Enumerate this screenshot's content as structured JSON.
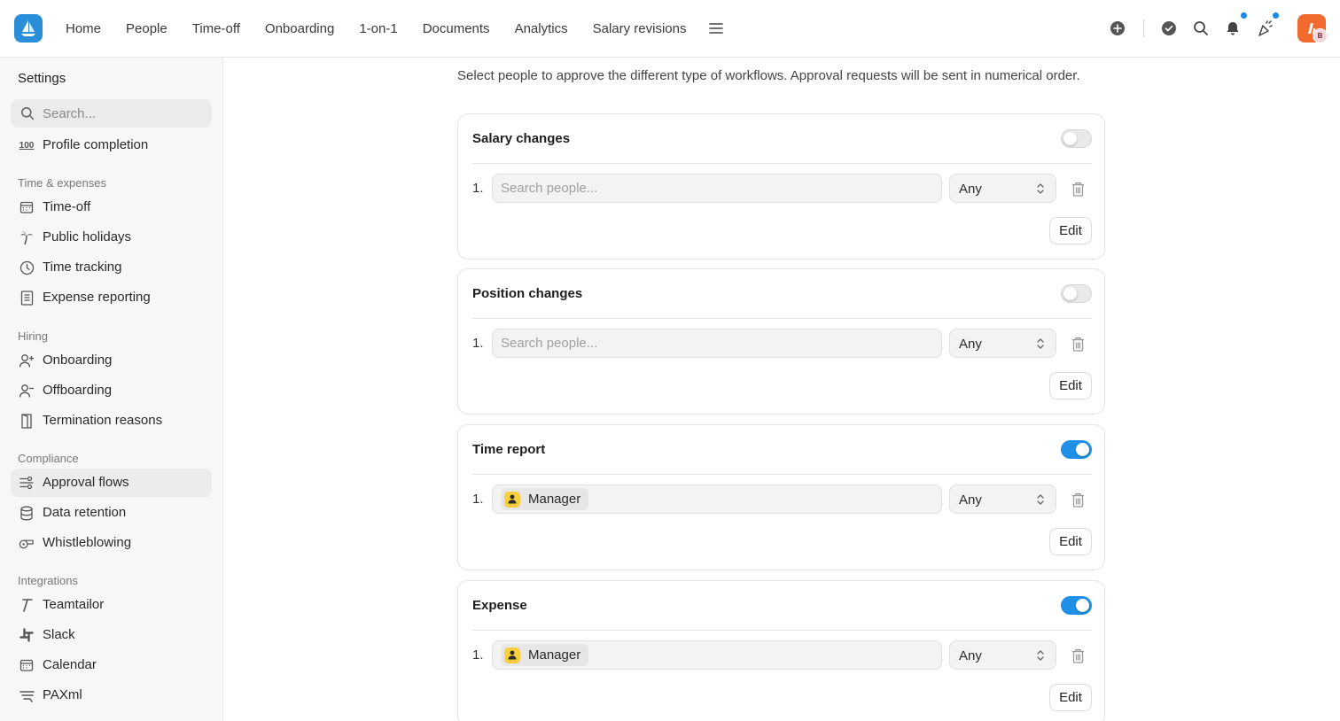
{
  "nav": {
    "items": [
      "Home",
      "People",
      "Time-off",
      "Onboarding",
      "1-on-1",
      "Documents",
      "Analytics",
      "Salary revisions"
    ]
  },
  "user": {
    "initial": "B"
  },
  "colors": {
    "accent": "#1e90e8",
    "logo": "#2b8ed8",
    "avatar": "#f26a2e"
  },
  "sidebar": {
    "title": "Settings",
    "search_placeholder": "Search...",
    "top_item": "Profile completion",
    "sections": {
      "time": "Time & expenses",
      "hiring": "Hiring",
      "compliance": "Compliance",
      "integrations": "Integrations"
    },
    "items": {
      "timeoff": "Time-off",
      "holidays": "Public holidays",
      "tracking": "Time tracking",
      "expense": "Expense reporting",
      "onboarding": "Onboarding",
      "offboarding": "Offboarding",
      "termination": "Termination reasons",
      "approval": "Approval flows",
      "retention": "Data retention",
      "whistle": "Whistleblowing",
      "teamtailor": "Teamtailor",
      "slack": "Slack",
      "calendar": "Calendar",
      "paxml": "PAXml"
    },
    "profile_icon_text": "100"
  },
  "main": {
    "intro": "Select people to approve the different type of workflows. Approval requests will be sent in numerical order.",
    "row_number": "1.",
    "search_placeholder": "Search people...",
    "select_value": "Any",
    "edit_label": "Edit",
    "chip_label": "Manager",
    "cards": [
      {
        "title": "Salary changes",
        "enabled": false
      },
      {
        "title": "Position changes",
        "enabled": false
      },
      {
        "title": "Time report",
        "enabled": true
      },
      {
        "title": "Expense",
        "enabled": true
      }
    ]
  }
}
